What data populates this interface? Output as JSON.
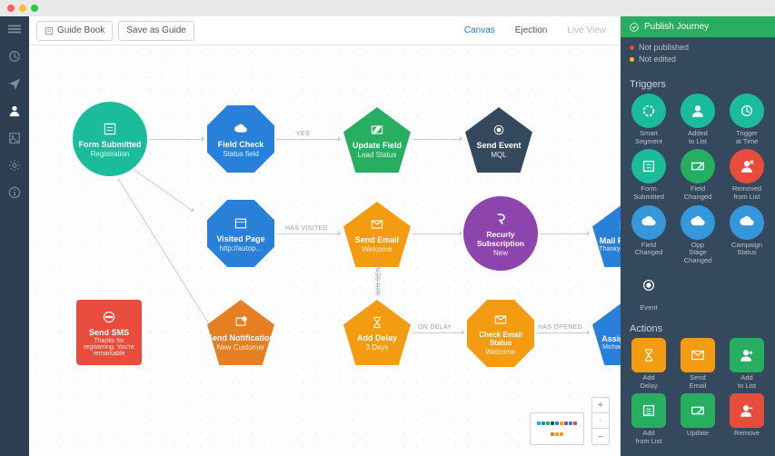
{
  "topbar": {
    "guide_book": "Guide Book",
    "save_as": "Save as Guide",
    "canvas": "Canvas",
    "ejection": "Ejection",
    "live_view": "Live View"
  },
  "panel": {
    "publish": "Publish Journey",
    "status": {
      "not_published": "Not published",
      "not_edited": "Not edited"
    },
    "triggers_h": "Triggers",
    "actions_h": "Actions",
    "triggers": [
      {
        "label": "Smart Segment",
        "color": "#1abc9c"
      },
      {
        "label": "Added to List",
        "color": "#1abc9c"
      },
      {
        "label": "Trigger at Time",
        "color": "#1abc9c"
      },
      {
        "label": "Form Submitted",
        "color": "#1abc9c"
      },
      {
        "label": "Field Changed",
        "color": "#27ae60"
      },
      {
        "label": "Removed from List",
        "color": "#e74c3c"
      },
      {
        "label": "Field Changed",
        "color": "#3498db"
      },
      {
        "label": "Opp Stage Changed",
        "color": "#3498db"
      },
      {
        "label": "Campaign Status",
        "color": "#3498db"
      },
      {
        "label": "Event",
        "color": "#34495e"
      }
    ],
    "actions": [
      {
        "label": "Add Delay",
        "color": "#f39c12"
      },
      {
        "label": "Send Email",
        "color": "#f39c12"
      },
      {
        "label": "Add to List",
        "color": "#27ae60"
      },
      {
        "label": "Add from List",
        "color": "#27ae60"
      },
      {
        "label": "Update",
        "color": "#27ae60"
      },
      {
        "label": "Remove",
        "color": "#e74c3c"
      }
    ]
  },
  "nodes": {
    "form_submitted": {
      "t": "Form Submitted",
      "s": "Registration"
    },
    "field_check": {
      "t": "Field Check",
      "s": "Status field"
    },
    "update_field": {
      "t": "Update Field",
      "s": "Lead Status"
    },
    "send_event": {
      "t": "Send Event",
      "s": "MQL"
    },
    "visited_page": {
      "t": "Visited Page",
      "s": "http://autop..."
    },
    "send_email": {
      "t": "Send Email",
      "s": "Welcome"
    },
    "recurly": {
      "t": "Recurly Subscription",
      "s": "New"
    },
    "mail_postcard": {
      "t": "Mail Postcard",
      "s": "Thankyou postca..."
    },
    "send_sms": {
      "t": "Send SMS",
      "s": "Thanks for registering. You're remarkable"
    },
    "send_notif": {
      "t": "Send Notification",
      "s": "New Customer"
    },
    "add_delay": {
      "t": "Add Delay",
      "s": "3 Days"
    },
    "check_email": {
      "t": "Check Email Status",
      "s": "Welcome"
    },
    "assign_lead": {
      "t": "Assign Lead",
      "s": "Michael Sharkey"
    }
  },
  "labels": {
    "yes": "YES",
    "has_visited": "HAS VISITED",
    "on_send": "ON SEND",
    "on_delay": "ON DELAY",
    "has_opened": "HAS OPENED"
  }
}
